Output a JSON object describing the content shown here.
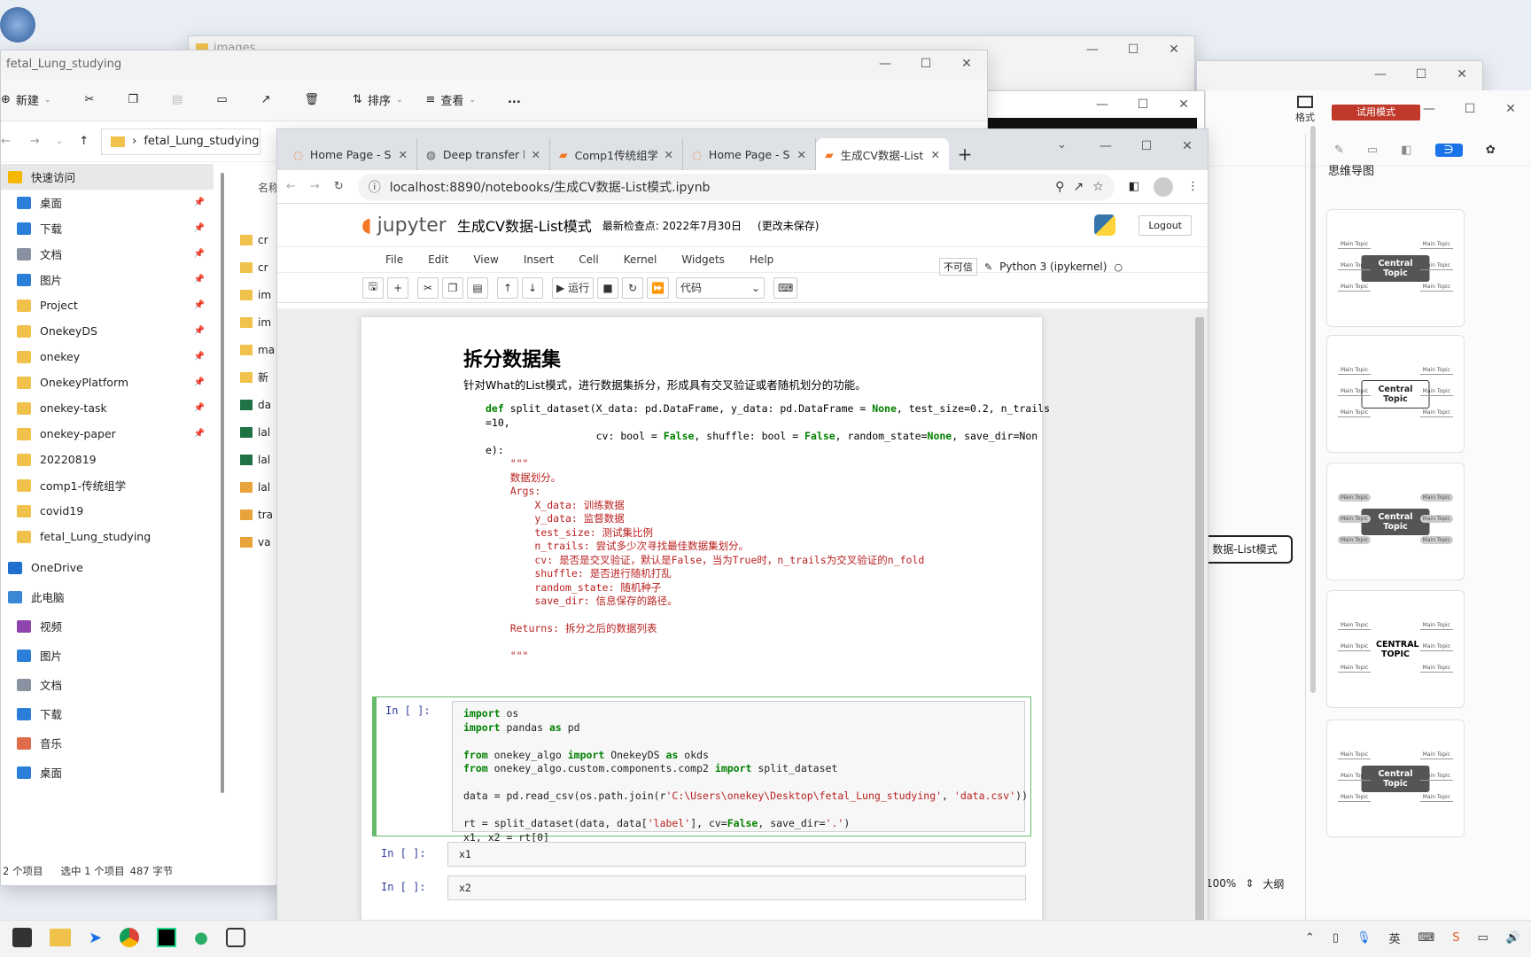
{
  "background_windows": {
    "images_title": "images",
    "statusbar": {
      "items_count": "2 个项目",
      "selected": "选中 1 个项目",
      "size": "487 字节"
    }
  },
  "explorer": {
    "title": "fetal_Lung_studying",
    "toolbar": {
      "new": "新建",
      "sort": "排序",
      "view": "查看",
      "more": "..."
    },
    "address": "fetal_Lung_studying",
    "col_header": "名称",
    "nav": [
      {
        "label": "快速访问",
        "icon": "star-icon"
      },
      {
        "label": "桌面",
        "icon": "desktop-icon",
        "pinned": true
      },
      {
        "label": "下载",
        "icon": "download-icon",
        "pinned": true
      },
      {
        "label": "文档",
        "icon": "document-icon",
        "pinned": true
      },
      {
        "label": "图片",
        "icon": "picture-icon",
        "pinned": true
      },
      {
        "label": "Project",
        "icon": "folder-icon",
        "pinned": true
      },
      {
        "label": "OnekeyDS",
        "icon": "folder-icon",
        "pinned": true
      },
      {
        "label": "onekey",
        "icon": "folder-icon",
        "pinned": true
      },
      {
        "label": "OnekeyPlatform",
        "icon": "folder-icon",
        "pinned": true
      },
      {
        "label": "onekey-task",
        "icon": "folder-icon",
        "pinned": true
      },
      {
        "label": "onekey-paper",
        "icon": "folder-icon",
        "pinned": true
      },
      {
        "label": "20220819",
        "icon": "folder-icon"
      },
      {
        "label": "comp1-传统组学",
        "icon": "folder-icon"
      },
      {
        "label": "covid19",
        "icon": "folder-icon"
      },
      {
        "label": "fetal_Lung_studying",
        "icon": "folder-icon"
      },
      {
        "label": "OneDrive",
        "icon": "cloud-icon"
      },
      {
        "label": "此电脑",
        "icon": "computer-icon"
      },
      {
        "label": "视频",
        "icon": "video-icon"
      },
      {
        "label": "图片",
        "icon": "picture-icon"
      },
      {
        "label": "文档",
        "icon": "document-icon"
      },
      {
        "label": "下载",
        "icon": "download-icon"
      },
      {
        "label": "音乐",
        "icon": "music-icon"
      },
      {
        "label": "桌面",
        "icon": "desktop-icon"
      }
    ],
    "files": [
      "cr",
      "cr",
      "im",
      "im",
      "ma",
      "新",
      "da",
      "lal",
      "lal",
      "lal",
      "tra",
      "va"
    ]
  },
  "browser": {
    "tabs": [
      {
        "label": "Home Page - Se",
        "icon": "jupyter-icon"
      },
      {
        "label": "Deep transfer le",
        "icon": "globe-icon"
      },
      {
        "label": "Comp1传统组学",
        "icon": "notebook-icon"
      },
      {
        "label": "Home Page - Se",
        "icon": "jupyter-icon"
      },
      {
        "label": "生成CV数据-List",
        "icon": "notebook-icon",
        "active": true
      }
    ],
    "url": "localhost:8890/notebooks/生成CV数据-List模式.ipynb"
  },
  "jupyter": {
    "logo": "jupyter",
    "notebook_title": "生成CV数据-List模式",
    "checkpoint": "最新检查点: 2022年7月30日",
    "unsaved": "(更改未保存)",
    "logout": "Logout",
    "menu": [
      "File",
      "Edit",
      "View",
      "Insert",
      "Cell",
      "Kernel",
      "Widgets",
      "Help"
    ],
    "trust": "不可信",
    "kernel": "Python 3 (ipykernel)",
    "run_label": "运行",
    "cell_type": "代码",
    "heading": "拆分数据集",
    "description": "针对What的List模式，进行数据集拆分，形成具有交叉验证或者随机划分的功能。",
    "code_lines": [
      "def split_dataset(X_data: pd.DataFrame, y_data: pd.DataFrame = None, test_size=0.2, n_trails",
      "=10,",
      "                  cv: bool = False, shuffle: bool = False, random_state=None, save_dir=Non",
      "e):",
      "    \"\"\"",
      "    数据划分。",
      "    Args:",
      "        X_data: 训练数据",
      "        y_data: 监督数据",
      "        test_size: 测试集比例",
      "        n_trails: 尝试多少次寻找最佳数据集划分。",
      "        cv: 是否是交叉验证，默认是False，当为True时，n_trails为交叉验证的n_fold",
      "        shuffle: 是否进行随机打乱",
      "        random_state: 随机种子",
      "        save_dir: 信息保存的路径。",
      "",
      "    Returns: 拆分之后的数据列表",
      "",
      "    \"\"\""
    ],
    "cells": [
      {
        "prompt": "In  [ ]:",
        "lines": [
          "import os",
          "import pandas as pd",
          "",
          "from onekey_algo import OnekeyDS as okds",
          "from onekey_algo.custom.components.comp2 import split_dataset",
          "",
          "data = pd.read_csv(os.path.join(r'C:\\Users\\onekey\\Desktop\\fetal_Lung_studying', 'data.csv'))",
          "",
          "rt = split_dataset(data, data['label'], cv=False, save_dir='.')",
          "x1, x2 = rt[0]"
        ]
      },
      {
        "prompt": "In  [ ]:",
        "lines": [
          "x1"
        ]
      },
      {
        "prompt": "In  [ ]:",
        "lines": [
          "x2"
        ]
      }
    ]
  },
  "mindmap_app": {
    "trial": "试用模式",
    "format_label": "格式",
    "panel_title": "思维导图",
    "templates": [
      {
        "center": "Central Topic",
        "topic": "Main Topic"
      },
      {
        "center": "Central Topic",
        "topic": "Main Topic"
      },
      {
        "center": "Central Topic",
        "topic": "Main Topic"
      },
      {
        "center": "CENTRAL TOPIC",
        "topic": "Main Topic"
      },
      {
        "center": "Central Topic",
        "topic": "Main Topic"
      }
    ],
    "canvas_node": "数据-List模式",
    "zoom": "100%",
    "outline": "大纲"
  },
  "colors": {
    "jupyter_orange": "#f37726",
    "cell_selected": "#66bb6a",
    "trial_red": "#c0392b",
    "accent_blue": "#1a73e8"
  }
}
